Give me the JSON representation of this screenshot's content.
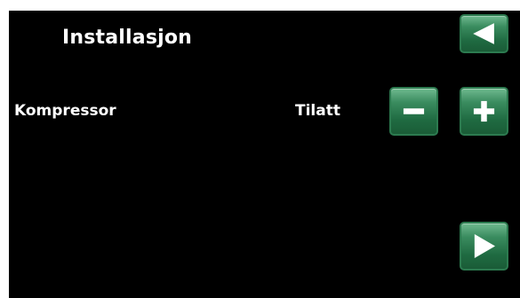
{
  "header": {
    "title": "Installasjon"
  },
  "setting": {
    "label": "Kompressor",
    "value": "Tilatt"
  },
  "buttons": {
    "back_icon": "triangle-left-icon",
    "minus_icon": "minus-icon",
    "plus_icon": "plus-icon",
    "next_icon": "triangle-right-icon"
  },
  "colors": {
    "screen_background": "#000000",
    "button_green": "#1f6a41",
    "text": "#ffffff"
  }
}
